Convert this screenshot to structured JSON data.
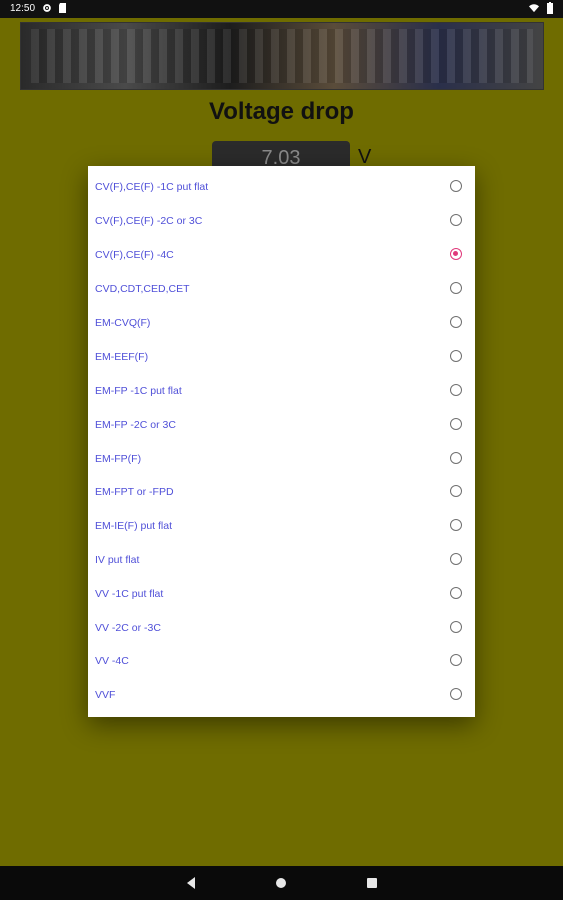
{
  "status_bar": {
    "time": "12:50",
    "left_icons": [
      "settings-icon",
      "sd-card-icon"
    ],
    "right_icons": [
      "wifi-icon",
      "battery-icon"
    ]
  },
  "page": {
    "title": "Voltage drop",
    "value": "7.03",
    "unit": "V"
  },
  "dialog": {
    "options": [
      {
        "label": "CV(F),CE(F) -1C put flat",
        "checked": false
      },
      {
        "label": "CV(F),CE(F) -2C or 3C",
        "checked": false
      },
      {
        "label": "CV(F),CE(F) -4C",
        "checked": true
      },
      {
        "label": "CVD,CDT,CED,CET",
        "checked": false
      },
      {
        "label": "EM-CVQ(F)",
        "checked": false
      },
      {
        "label": "EM-EEF(F)",
        "checked": false
      },
      {
        "label": "EM-FP -1C put flat",
        "checked": false
      },
      {
        "label": "EM-FP -2C or 3C",
        "checked": false
      },
      {
        "label": "EM-FP(F)",
        "checked": false
      },
      {
        "label": "EM-FPT or -FPD",
        "checked": false
      },
      {
        "label": "EM-IE(F) put flat",
        "checked": false
      },
      {
        "label": "IV put flat",
        "checked": false
      },
      {
        "label": "VV -1C put flat",
        "checked": false
      },
      {
        "label": "VV -2C or -3C",
        "checked": false
      },
      {
        "label": "VV -4C",
        "checked": false
      },
      {
        "label": "VVF",
        "checked": false
      }
    ]
  },
  "nav_bar": {
    "buttons": [
      "back-icon",
      "home-icon",
      "recents-icon"
    ]
  },
  "colors": {
    "background": "#6f6c00",
    "accent": "#e0397a",
    "option_text": "#5050d8"
  }
}
